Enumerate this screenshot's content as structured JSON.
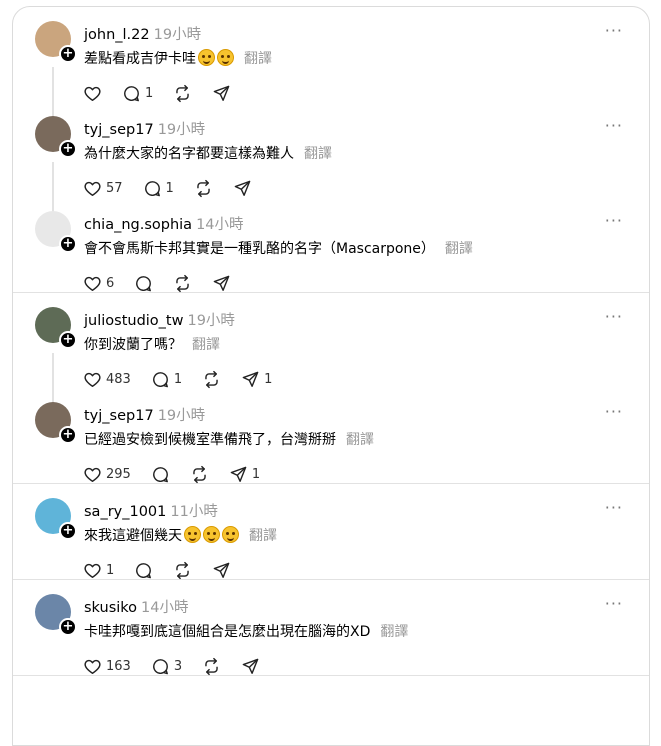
{
  "translate_label": "翻譯",
  "more_label": "···",
  "plus_label": "+",
  "groups": [
    {
      "posts": [
        {
          "username": "john_l.22",
          "time": "19小時",
          "text": "差點看成吉伊卡哇",
          "emojis": 2,
          "likes": "",
          "replies": "1",
          "reposts": "",
          "shares": "",
          "avatar": "#caa57e"
        },
        {
          "username": "tyj_sep17",
          "time": "19小時",
          "text": "為什麼大家的名字都要這樣為難人",
          "emojis": 0,
          "likes": "57",
          "replies": "1",
          "reposts": "",
          "shares": "",
          "avatar": "#7a6a5c"
        },
        {
          "username": "chia_ng.sophia",
          "time": "14小時",
          "text": "會不會馬斯卡邦其實是一種乳酪的名字（Mascarpone）",
          "emojis": 0,
          "likes": "6",
          "replies": "",
          "reposts": "",
          "shares": "",
          "avatar": "#e8e8e8"
        }
      ]
    },
    {
      "posts": [
        {
          "username": "juliostudio_tw",
          "time": "19小時",
          "text": "你到波蘭了嗎？",
          "emojis": 0,
          "likes": "483",
          "replies": "1",
          "reposts": "",
          "shares": "1",
          "avatar": "#5e6b56"
        },
        {
          "username": "tyj_sep17",
          "time": "19小時",
          "text": "已經過安檢到候機室準備飛了，台灣掰掰",
          "emojis": 0,
          "likes": "295",
          "replies": "",
          "reposts": "",
          "shares": "1",
          "avatar": "#7a6a5c"
        }
      ]
    },
    {
      "posts": [
        {
          "username": "sa_ry_1001",
          "time": "11小時",
          "text": "來我這避個幾天",
          "emojis": 3,
          "likes": "1",
          "replies": "",
          "reposts": "",
          "shares": "",
          "avatar": "#5fb4d9"
        }
      ]
    },
    {
      "posts": [
        {
          "username": "skusiko",
          "time": "14小時",
          "text": "卡哇邦嘎到底這個組合是怎麼出現在腦海的XD",
          "emojis": 0,
          "likes": "163",
          "replies": "3",
          "reposts": "",
          "shares": "",
          "avatar": "#6b86a8"
        }
      ]
    }
  ]
}
